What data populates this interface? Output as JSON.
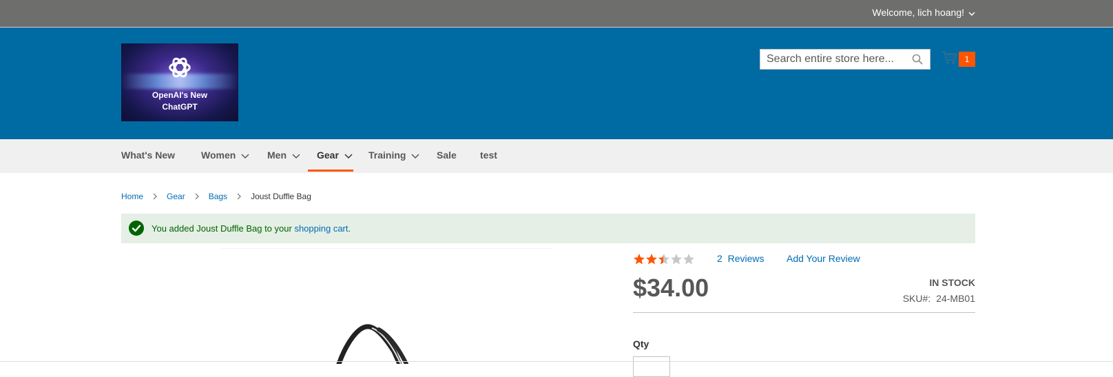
{
  "header": {
    "welcome": "Welcome, lich hoang!",
    "logo": {
      "line1": "OpenAI's New",
      "line2": "ChatGPT"
    },
    "search_placeholder": "Search entire store here...",
    "cart_count": "1"
  },
  "nav": [
    {
      "label": "What's New",
      "dropdown": false
    },
    {
      "label": "Women",
      "dropdown": true
    },
    {
      "label": "Men",
      "dropdown": true
    },
    {
      "label": "Gear",
      "dropdown": true,
      "active": true
    },
    {
      "label": "Training",
      "dropdown": true
    },
    {
      "label": "Sale",
      "dropdown": false
    },
    {
      "label": "test",
      "dropdown": false
    }
  ],
  "breadcrumbs": [
    "Home",
    "Gear",
    "Bags",
    "Joust Duffle Bag"
  ],
  "message": {
    "prefix": "You added Joust Duffle Bag to your ",
    "link": "shopping cart",
    "suffix": "."
  },
  "product": {
    "rating_stars": 2.5,
    "rating_max": 5,
    "reviews_count": "2",
    "reviews_label": "Reviews",
    "add_review": "Add Your Review",
    "price": "$34.00",
    "stock": "IN STOCK",
    "sku_label": "SKU#:",
    "sku": "24-MB01",
    "qty_label": "Qty"
  },
  "colors": {
    "header_blue": "#006aa3",
    "panel_gray": "#6e6f6c",
    "accent_orange": "#ff5501",
    "link_blue": "#006bb4",
    "success_green": "#006400"
  },
  "icons": [
    "chevron-down-icon",
    "search-icon",
    "cart-icon",
    "checkmark-icon",
    "star-icon",
    "chevron-right-icon"
  ]
}
